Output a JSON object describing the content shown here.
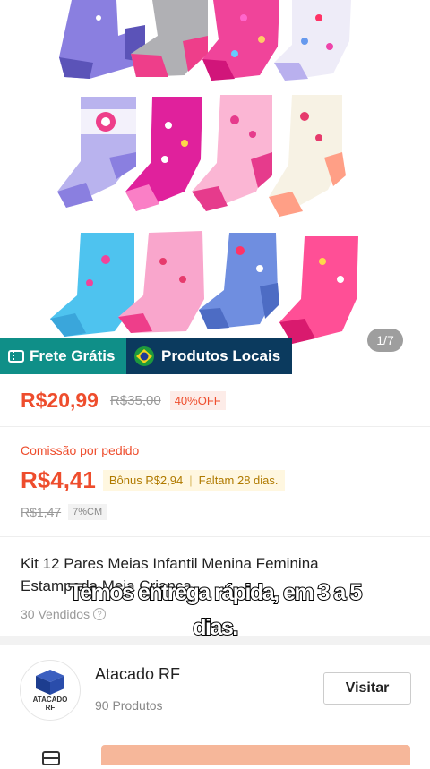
{
  "gallery": {
    "counter": "1/7"
  },
  "badges": {
    "frete": "Frete Grátis",
    "locais": "Produtos Locais"
  },
  "price": {
    "current": "R$20,99",
    "original": "R$35,00",
    "discount": "40%OFF"
  },
  "commission": {
    "label": "Comissão por pedido",
    "value": "R$4,41",
    "bonus": "Bônus R$2,94",
    "deadline": "Faltam 28 dias.",
    "old_value": "R$1,47",
    "rate": "7%CM"
  },
  "product": {
    "title": "Kit 12 Pares Meias Infantil Menina Feminina Estampada Meia Criança",
    "sold": "30 Vendidos"
  },
  "caption": {
    "line1": "Temos entrega rápida, em 3 a 5",
    "line2": "dias."
  },
  "shop": {
    "logo_line1": "ATACADO",
    "logo_line2": "RF",
    "name": "Atacado RF",
    "products": "90 Produtos",
    "visit": "Visitar"
  },
  "colors": {
    "accent": "#ee4d2d",
    "frete_bg": "#0f8f88",
    "locais_bg": "#0b3a5e"
  }
}
